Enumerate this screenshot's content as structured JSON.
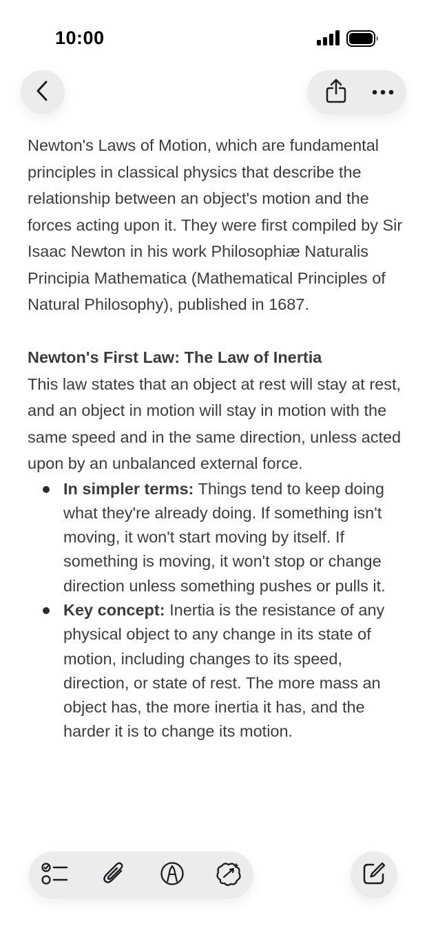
{
  "status_bar": {
    "time": "10:00",
    "signal_icon": "cellular-signal-icon",
    "battery_icon": "battery-icon"
  },
  "nav": {
    "back_icon": "chevron-left-icon",
    "share_icon": "share-icon",
    "more_icon": "ellipsis-icon"
  },
  "note": {
    "intro": "Newton's Laws of Motion, which are fundamental principles in classical physics that describe the relationship between an object's motion and the forces acting upon it. They were first compiled by Sir Isaac Newton in his work Philosophiæ Naturalis Principia Mathematica (Mathematical Principles of Natural Philosophy), published in 1687.",
    "heading": "Newton's First Law: The Law of Inertia",
    "body": "This law states that an object at rest will stay at rest, and an object in motion will stay in motion with the same speed and in the same direction, unless acted upon by an unbalanced external force.",
    "bullets": [
      {
        "label": "In simpler terms:",
        "text": " Things tend to keep doing what they're already doing. If something isn't moving, it won't start moving by itself. If something is moving, it won't stop or change direction unless something pushes or pulls it."
      },
      {
        "label": "Key concept:",
        "text": " Inertia is the resistance of any physical object to any change in its state of motion, including changes to its speed, direction, or state of rest. The more mass an object has, the more inertia it has, and the harder it is to change its motion."
      }
    ]
  },
  "toolbar": {
    "checklist_icon": "checklist-icon",
    "attachment_icon": "paperclip-icon",
    "markup_icon": "markup-pen-icon",
    "ai_icon": "apple-intelligence-icon",
    "compose_icon": "compose-icon"
  }
}
